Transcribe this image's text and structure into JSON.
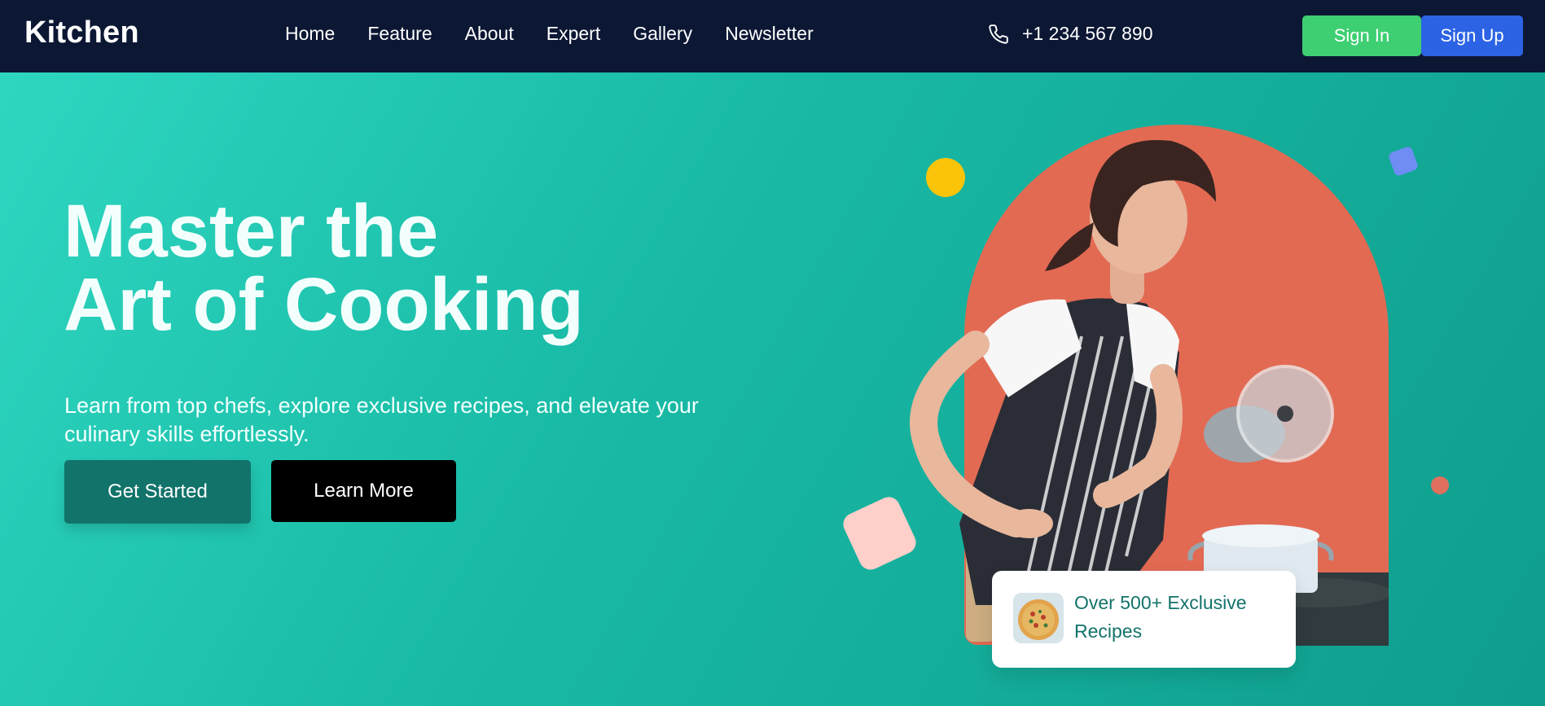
{
  "brand": {
    "logo_text": "Kitchen"
  },
  "nav": {
    "links": [
      {
        "label": "Home"
      },
      {
        "label": "Feature"
      },
      {
        "label": "About"
      },
      {
        "label": "Expert"
      },
      {
        "label": "Gallery"
      },
      {
        "label": "Newsletter"
      }
    ],
    "phone": {
      "icon": "phone-icon",
      "number": "+1 234 567 890"
    },
    "sign_in_label": "Sign In",
    "sign_up_label": "Sign Up"
  },
  "hero": {
    "title_line1": "Master the",
    "title_line2": "Art of Cooking",
    "subtitle": "Learn from top chefs, explore exclusive recipes, and elevate your culinary skills effortlessly.",
    "primary_cta": "Get Started",
    "secondary_cta": "Learn More",
    "recipes_card": {
      "icon": "pizza-thumbnail",
      "text": "Over 500+ Exclusive Recipes"
    }
  },
  "colors": {
    "nav_bg": "#0c1734",
    "hero_gradient_start": "#2ed6c0",
    "hero_gradient_end": "#0f9d8d",
    "sign_in": "#3ecf72",
    "sign_up": "#2b63e4",
    "get_started": "#12736a",
    "learn_more": "#000000",
    "arch": "#e26a53",
    "accent_yellow": "#fcc409",
    "accent_blue": "#6f8df4",
    "accent_pink": "#ffcfc9"
  }
}
